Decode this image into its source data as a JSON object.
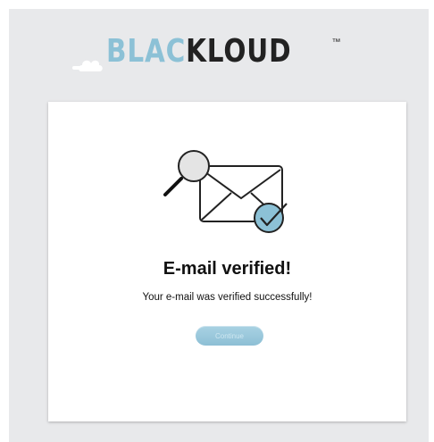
{
  "logo": {
    "part_light": "BLAC",
    "part_dark": "KLOUD",
    "trademark": "™",
    "icon": "cloud-icon"
  },
  "card": {
    "illustration_icon": "email-verified-icon",
    "title": "E-mail verified!",
    "message": "Your e-mail was verified successfully!",
    "button_label": "Continue"
  },
  "colors": {
    "background": "#e8e9eb",
    "card": "#ffffff",
    "accent": "#8cc1d6",
    "logo_dark": "#222222"
  }
}
